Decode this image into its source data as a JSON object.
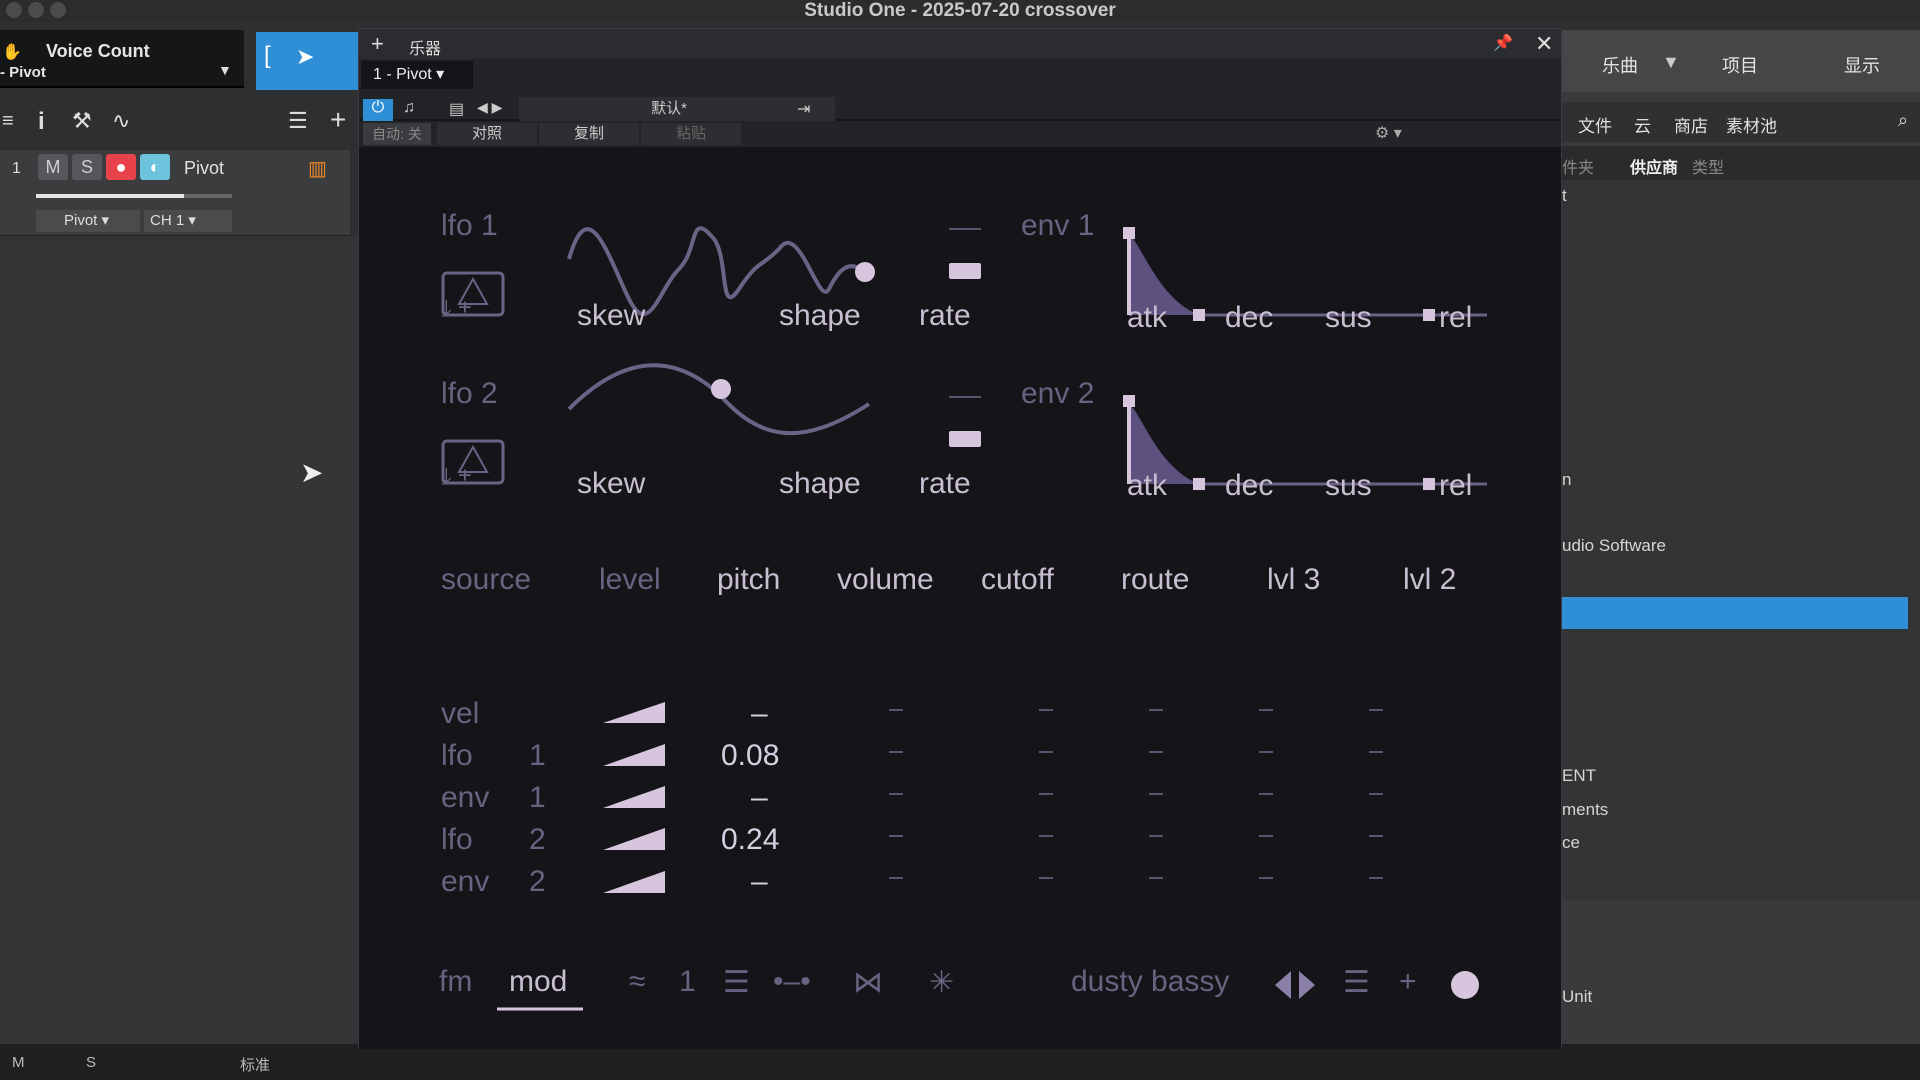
{
  "app": {
    "title": "Studio One - 2025-07-20 crossover"
  },
  "left": {
    "instrument_title": "Voice Count",
    "instrument_sub": "- Pivot",
    "track_num": "1",
    "mute": "M",
    "solo": "S",
    "track_name": "Pivot",
    "instrument_selector": "Pivot",
    "channel": "CH 1"
  },
  "bottom": {
    "m": "M",
    "s": "S",
    "mode": "标准"
  },
  "right": {
    "tabs": [
      "乐曲",
      "项目",
      "显示"
    ],
    "menu": [
      "文件",
      "云",
      "商店",
      "素材池"
    ],
    "sub": [
      "件夹",
      "供应商",
      "类型"
    ],
    "items": [
      "t",
      "n",
      "udio Software",
      "ENT",
      "ments",
      "ce",
      "Unit"
    ]
  },
  "plugin": {
    "window_title": "乐器",
    "preset_slot": "1 - Pivot",
    "preset_name": "默认*",
    "auto": "自动: 关",
    "compare": "对照",
    "copy": "复制",
    "paste": "粘贴",
    "lfo1": "lfo 1",
    "lfo2": "lfo 2",
    "env1": "env 1",
    "env2": "env 2",
    "skew": "skew",
    "shape": "shape",
    "rate": "rate",
    "atk": "atk",
    "dec": "dec",
    "sus": "sus",
    "rel": "rel",
    "headers": [
      "source",
      "level",
      "pitch",
      "volume",
      "cutoff",
      "route",
      "lvl 3",
      "lvl 2"
    ],
    "rows": [
      {
        "source": "vel",
        "idx": "",
        "pitch": "–"
      },
      {
        "source": "lfo",
        "idx": "1",
        "pitch": "0.08"
      },
      {
        "source": "env",
        "idx": "1",
        "pitch": "–"
      },
      {
        "source": "lfo",
        "idx": "2",
        "pitch": "0.24"
      },
      {
        "source": "env",
        "idx": "2",
        "pitch": "–"
      }
    ],
    "dash": "–",
    "footer": {
      "fm": "fm",
      "mod": "mod",
      "voices": "1",
      "preset": "dusty bassy"
    }
  }
}
